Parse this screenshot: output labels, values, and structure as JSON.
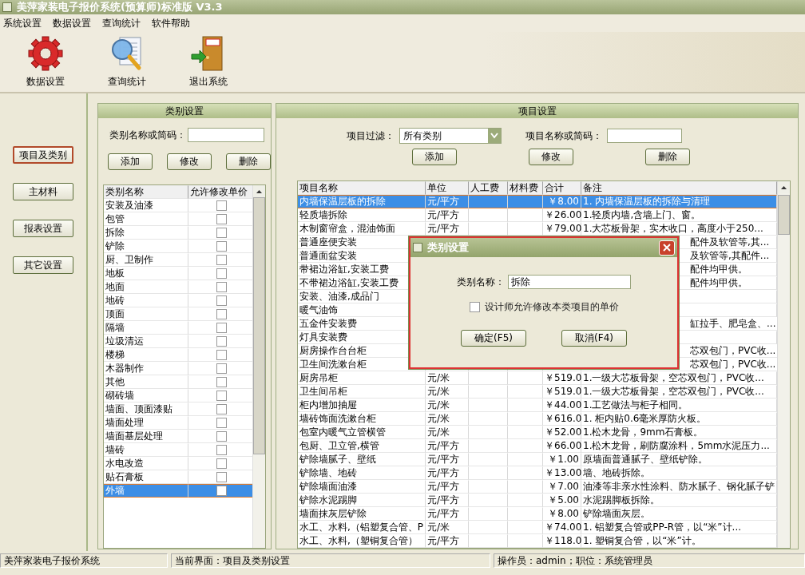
{
  "window": {
    "title": "美萍家装电子报价系统(预算师)标准版 V3.3"
  },
  "menu": [
    "系统设置",
    "数据设置",
    "查询统计",
    "软件帮助"
  ],
  "toolbar": [
    {
      "label": "数据设置",
      "kind": "gear"
    },
    {
      "label": "查询统计",
      "kind": "search"
    },
    {
      "label": "退出系统",
      "kind": "exit"
    }
  ],
  "nav": [
    {
      "label": "项目及类别",
      "selected": true
    },
    {
      "label": "主材料",
      "selected": false
    },
    {
      "label": "报表设置",
      "selected": false
    },
    {
      "label": "其它设置",
      "selected": false
    }
  ],
  "category_panel": {
    "title": "类别设置",
    "search_label": "类别名称或简码：",
    "buttons": [
      "添加",
      "修改",
      "删除"
    ],
    "columns": [
      "类别名称",
      "允许修改单价"
    ],
    "rows": [
      {
        "name": "安装及油漆",
        "checked": false,
        "selected": false
      },
      {
        "name": "包管",
        "checked": false,
        "selected": false
      },
      {
        "name": "拆除",
        "checked": false,
        "selected": false
      },
      {
        "name": "铲除",
        "checked": false,
        "selected": false
      },
      {
        "name": "厨、卫制作",
        "checked": false,
        "selected": false
      },
      {
        "name": "地板",
        "checked": false,
        "selected": false
      },
      {
        "name": "地面",
        "checked": false,
        "selected": false
      },
      {
        "name": "地砖",
        "checked": false,
        "selected": false
      },
      {
        "name": "顶面",
        "checked": false,
        "selected": false
      },
      {
        "name": "隔墙",
        "checked": false,
        "selected": false
      },
      {
        "name": "垃圾清运",
        "checked": false,
        "selected": false
      },
      {
        "name": "楼梯",
        "checked": false,
        "selected": false
      },
      {
        "name": "木器制作",
        "checked": false,
        "selected": false
      },
      {
        "name": "其他",
        "checked": false,
        "selected": false
      },
      {
        "name": "砌砖墙",
        "checked": false,
        "selected": false
      },
      {
        "name": "墙面、顶面漆贴",
        "checked": false,
        "selected": false
      },
      {
        "name": "墙面处理",
        "checked": false,
        "selected": false
      },
      {
        "name": "墙面基层处理",
        "checked": false,
        "selected": false
      },
      {
        "name": "墙砖",
        "checked": false,
        "selected": false
      },
      {
        "name": "水电改造",
        "checked": false,
        "selected": false
      },
      {
        "name": "贴石膏板",
        "checked": false,
        "selected": false
      },
      {
        "name": "外墙",
        "checked": false,
        "selected": true
      }
    ]
  },
  "project_panel": {
    "title": "项目设置",
    "filter_label": "项目过滤：",
    "filter_value": "所有类别",
    "search_label": "项目名称或简码：",
    "buttons": [
      "添加",
      "修改",
      "删除"
    ],
    "columns": [
      "项目名称",
      "单位",
      "人工费",
      "材料费",
      "合计",
      "备注"
    ],
    "rows": [
      {
        "name": "内墙保温层板的拆除",
        "unit": "元/平方",
        "total": "￥8.00",
        "note": "1. 内墙保温层板的拆除与清理",
        "selected": true,
        "covered": false
      },
      {
        "name": "轻质墙拆除",
        "unit": "元/平方",
        "total": "￥26.00",
        "note": "1.轻质内墙,含墙上门、窗。",
        "selected": false,
        "covered": false
      },
      {
        "name": "木制窗帘盒，混油饰面",
        "unit": "元/平方",
        "total": "￥79.00",
        "note": "1.大芯板骨架，实木收口，高度小于250...",
        "selected": false,
        "covered": false
      },
      {
        "name": "普通座便安装",
        "note": "配件及软管等,其...",
        "selected": false,
        "covered": true
      },
      {
        "name": "普通面盆安装",
        "note": "及软管等,其配件...",
        "selected": false,
        "covered": true
      },
      {
        "name": "带裙边浴缸,安装工费",
        "note": "配件均甲供。",
        "selected": false,
        "covered": true
      },
      {
        "name": "不带裙边浴缸,安装工费",
        "note": "配件均甲供。",
        "selected": false,
        "covered": true
      },
      {
        "name": "安装、油漆,成品门",
        "selected": false
      },
      {
        "name": "暖气油饰",
        "selected": false
      },
      {
        "name": "五金件安装费",
        "note": "缸拉手、肥皂盒、...",
        "selected": false,
        "covered": true
      },
      {
        "name": "灯具安装费",
        "selected": false
      },
      {
        "name": "厨房操作台台柜",
        "note": "芯双包门，PVC收...",
        "selected": false,
        "covered": true
      },
      {
        "name": "卫生间洗漱台柜",
        "note": "芯双包门，PVC收...",
        "selected": false,
        "covered": true
      },
      {
        "name": "厨房吊柜",
        "unit": "元/米",
        "total": "￥519.0",
        "note": "1.一级大芯板骨架，空芯双包门，PVC收...",
        "selected": false,
        "covered": false
      },
      {
        "name": "卫生间吊柜",
        "unit": "元/米",
        "total": "￥519.0",
        "note": "1.一级大芯板骨架，空芯双包门，PVC收...",
        "selected": false,
        "covered": false
      },
      {
        "name": "柜内增加抽屉",
        "unit": "元/米",
        "total": "￥44.00",
        "note": "1.工艺做法与柜子相同。",
        "selected": false,
        "covered": false
      },
      {
        "name": "墙砖饰面洗漱台柜",
        "unit": "元/米",
        "total": "￥616.0",
        "note": "1. 柜内贴0.6毫米厚防火板。",
        "selected": false,
        "covered": false
      },
      {
        "name": "包室内暖气立管横管",
        "unit": "元/米",
        "total": "￥52.00",
        "note": "1.松木龙骨，9mm石膏板。",
        "selected": false,
        "covered": false
      },
      {
        "name": "包厨、卫立管,横管",
        "unit": "元/平方",
        "total": "￥66.00",
        "note": "1.松木龙骨，刷防腐涂料，5mm水泥压力...",
        "selected": false,
        "covered": false
      },
      {
        "name": "铲除墙腻子、壁纸",
        "unit": "元/平方",
        "total": "￥1.00",
        "note": "原墙面普通腻子、壁纸铲除。",
        "selected": false,
        "covered": false
      },
      {
        "name": "铲除墙、地砖",
        "unit": "元/平方",
        "total": "￥13.00",
        "note": "墙、地砖拆除。",
        "selected": false,
        "covered": false
      },
      {
        "name": "铲除墙面油漆",
        "unit": "元/平方",
        "total": "￥7.00",
        "note": "油漆等非亲水性涂料、防水腻子、钢化腻子铲",
        "selected": false,
        "covered": false
      },
      {
        "name": "铲除水泥踢脚",
        "unit": "元/平方",
        "total": "￥5.00",
        "note": "水泥踢脚板拆除。",
        "selected": false,
        "covered": false
      },
      {
        "name": "墙面抹灰层铲除",
        "unit": "元/平方",
        "total": "￥8.00",
        "note": "铲除墙面灰层。",
        "selected": false,
        "covered": false
      },
      {
        "name": "水工、水料,（铝塑复合管、P",
        "unit": "元/米",
        "total": "￥74.00",
        "note": "1. 铝塑复合管或PP-R管，以“米”计...",
        "selected": false,
        "covered": false
      },
      {
        "name": "水工、水料,（塑铜复合管）",
        "unit": "元/平方",
        "total": "￥118.0",
        "note": "1. 塑铜复合管，以“米”计。",
        "selected": false,
        "covered": false
      }
    ]
  },
  "dialog": {
    "title": "类别设置",
    "name_label": "类别名称：",
    "name_value": "拆除",
    "checkbox": {
      "label": "设计师允许修改本类项目的单价",
      "checked": false
    },
    "buttons": [
      "确定(F5)",
      "取消(F4)"
    ]
  },
  "status_bar": [
    "美萍家装电子报价系统",
    "当前界面：项目及类别设置",
    "操作员：admin；职位：系统管理员"
  ]
}
